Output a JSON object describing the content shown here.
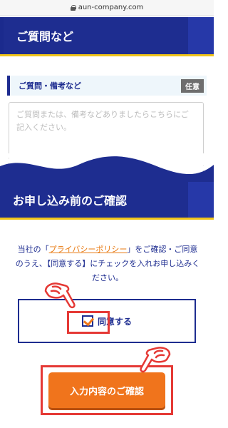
{
  "browser": {
    "url": "aun-company.com"
  },
  "section_questions": {
    "title": "ご質問など",
    "field_label": "ご質問・備考など",
    "badge": "任意",
    "textarea_placeholder": "ご質問または、備考などありましたらこちらにご記入ください。"
  },
  "section_confirm": {
    "title": "お申し込み前のご確認",
    "notice_prefix": "当社の「",
    "notice_link": "プライバシーポリシー",
    "notice_suffix": "」をご確認・ご同意のうえ、【同意する】にチェックを入れお申し込みください。",
    "agree_label": "同意する",
    "agree_checked": true
  },
  "submit": {
    "label": "入力内容のご確認"
  },
  "colors": {
    "navy": "#1e2d90",
    "accent": "#f0741c",
    "highlight": "#e53935"
  }
}
